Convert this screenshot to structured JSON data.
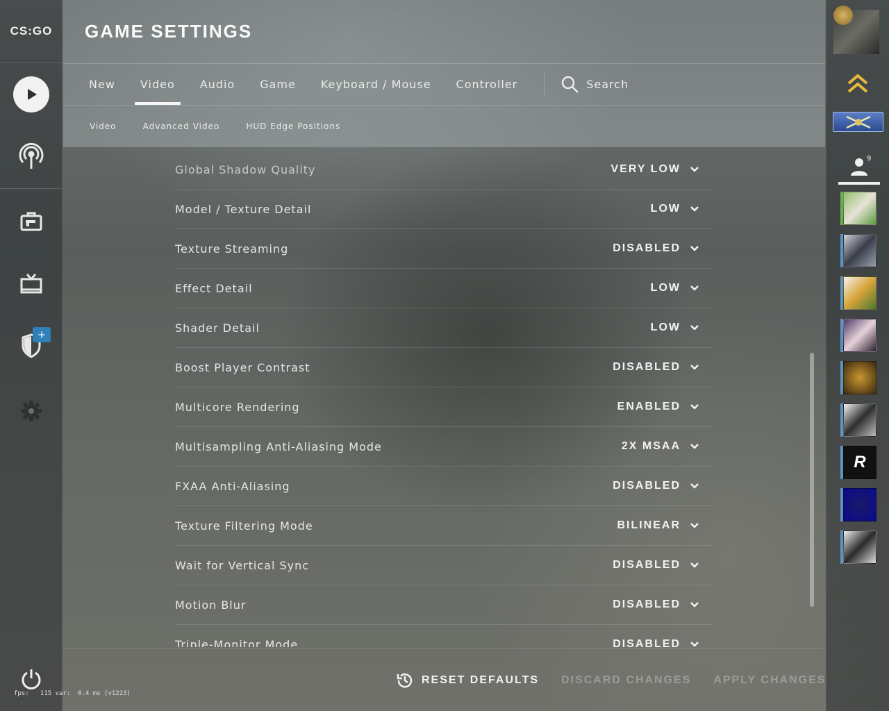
{
  "app": {
    "logo_text": "CS:GO"
  },
  "header": {
    "title": "GAME SETTINGS"
  },
  "tabs": [
    {
      "label": "New"
    },
    {
      "label": "Video",
      "active": true
    },
    {
      "label": "Audio"
    },
    {
      "label": "Game"
    },
    {
      "label": "Keyboard / Mouse"
    },
    {
      "label": "Controller"
    }
  ],
  "search": {
    "label": "Search"
  },
  "subtabs": [
    {
      "label": "Video"
    },
    {
      "label": "Advanced Video"
    },
    {
      "label": "HUD Edge Positions"
    }
  ],
  "settings": [
    {
      "label": "Global Shadow Quality",
      "value": "VERY LOW"
    },
    {
      "label": "Model / Texture Detail",
      "value": "LOW"
    },
    {
      "label": "Texture Streaming",
      "value": "DISABLED"
    },
    {
      "label": "Effect Detail",
      "value": "LOW"
    },
    {
      "label": "Shader Detail",
      "value": "LOW"
    },
    {
      "label": "Boost Player Contrast",
      "value": "DISABLED"
    },
    {
      "label": "Multicore Rendering",
      "value": "ENABLED"
    },
    {
      "label": "Multisampling Anti-Aliasing Mode",
      "value": "2X MSAA"
    },
    {
      "label": "FXAA Anti-Aliasing",
      "value": "DISABLED"
    },
    {
      "label": "Texture Filtering Mode",
      "value": "BILINEAR"
    },
    {
      "label": "Wait for Vertical Sync",
      "value": "DISABLED"
    },
    {
      "label": "Motion Blur",
      "value": "DISABLED"
    },
    {
      "label": "Triple-Monitor Mode",
      "value": "DISABLED"
    }
  ],
  "footer": {
    "reset": "RESET DEFAULTS",
    "discard": "DISCARD CHANGES",
    "apply": "APPLY CHANGES"
  },
  "left_nav": {
    "icons": [
      "play-icon",
      "broadcast-icon",
      "inventory-icon",
      "watch-tv-icon",
      "shield-icon",
      "gear-icon",
      "power-icon"
    ],
    "badge": "+"
  },
  "friends": {
    "count": "9"
  },
  "fps_text": "fps:   115 var:  0.4 ms (v1223)",
  "colors": {
    "accent_blue": "#2f7fb8",
    "text_primary": "#e6e6e6",
    "text_disabled": "#8a8a8a"
  }
}
